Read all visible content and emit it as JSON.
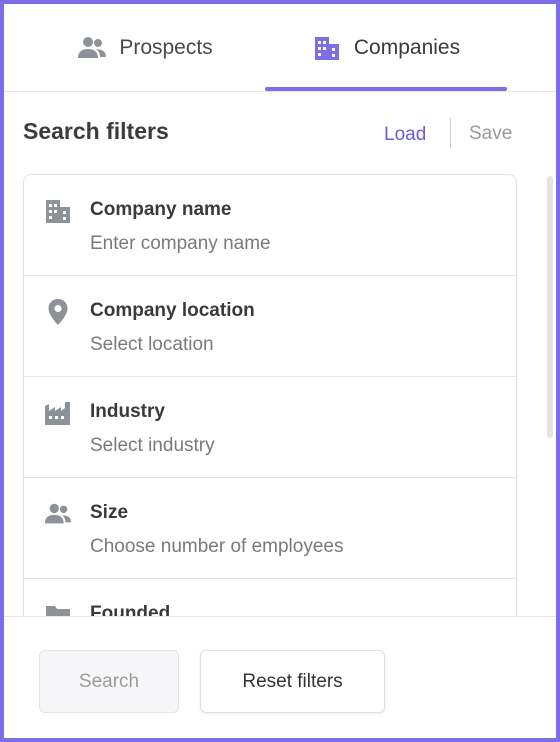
{
  "tabs": {
    "prospects": {
      "label": "Prospects",
      "icon": "people-icon"
    },
    "companies": {
      "label": "Companies",
      "icon": "building-icon",
      "active": true
    }
  },
  "colors": {
    "accent": "#7b6ee6",
    "link": "#6a5cdb",
    "icon": "#8d9298"
  },
  "header": {
    "title": "Search filters",
    "load_label": "Load",
    "save_label": "Save"
  },
  "filters": [
    {
      "title": "Company name",
      "placeholder": "Enter company name",
      "icon": "building-icon"
    },
    {
      "title": "Company location",
      "placeholder": "Select location",
      "icon": "location-pin-icon"
    },
    {
      "title": "Industry",
      "placeholder": "Select industry",
      "icon": "factory-icon"
    },
    {
      "title": "Size",
      "placeholder": "Choose number of employees",
      "icon": "people-icon"
    },
    {
      "title": "Founded",
      "placeholder": "",
      "icon": "folder-icon"
    }
  ],
  "footer": {
    "search_label": "Search",
    "reset_label": "Reset filters"
  }
}
